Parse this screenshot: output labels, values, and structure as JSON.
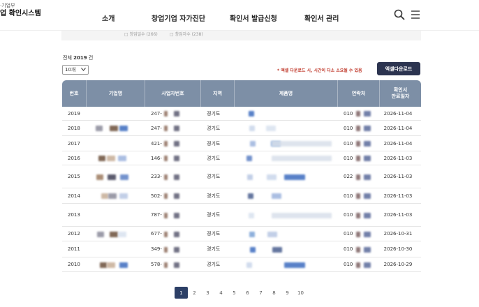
{
  "header": {
    "logo_sub": "·기업부",
    "logo_main": "업 확인시스템",
    "nav": [
      "소개",
      "창업기업 자가진단",
      "확인서 발급신청",
      "확인서 관리"
    ]
  },
  "filter": {
    "options": [
      "□ 창업일수 (266)",
      "□ 창업자수 (238)"
    ]
  },
  "list": {
    "total_label": "전체",
    "total_count": "2019",
    "total_unit": "건",
    "page_size": "10개",
    "note": "* 엑셀 다운로드 시, 시간이 다소 소요될 수 있음",
    "excel_button": "엑셀다운로드"
  },
  "table": {
    "headers": [
      "번호",
      "기업명",
      "사업자번호",
      "지역",
      "제품명",
      "연락처",
      "확인서\n만료일자"
    ],
    "rows": [
      {
        "no": "2019",
        "biz": "247-",
        "region": "경기도",
        "phone": "010",
        "date": "2026-11-04"
      },
      {
        "no": "2018",
        "biz": "247-",
        "region": "경기도",
        "phone": "010",
        "date": "2026-11-04"
      },
      {
        "no": "2017",
        "biz": "421-",
        "region": "경기도",
        "phone": "010",
        "date": "2026-11-04"
      },
      {
        "no": "2016",
        "biz": "146-",
        "region": "경기도",
        "phone": "010",
        "date": "2026-11-03"
      },
      {
        "no": "2015",
        "biz": "233-",
        "region": "경기도",
        "phone": "022",
        "date": "2026-11-03"
      },
      {
        "no": "2014",
        "biz": "502-",
        "region": "경기도",
        "phone": "010",
        "date": "2026-11-03"
      },
      {
        "no": "2013",
        "biz": "787-",
        "region": "경기도",
        "phone": "010",
        "date": "2026-11-03"
      },
      {
        "no": "2012",
        "biz": "677-",
        "region": "경기도",
        "phone": "010",
        "date": "2026-10-31"
      },
      {
        "no": "2011",
        "biz": "349-",
        "region": "경기도",
        "phone": "010",
        "date": "2026-10-30"
      },
      {
        "no": "2010",
        "biz": "578-",
        "region": "경기도",
        "phone": "010",
        "date": "2026-10-29"
      }
    ]
  },
  "pagination": {
    "pages": [
      "1",
      "2",
      "3",
      "4",
      "5",
      "6",
      "7",
      "8",
      "9",
      "10"
    ],
    "active": "1"
  },
  "colors": {
    "header_bg": "#7d8fa6",
    "button_bg": "#2c3450",
    "active_page": "#2c3f66",
    "note": "#c0392b"
  },
  "icons": [
    "search-icon",
    "menu-icon",
    "chevron-down-icon"
  ]
}
